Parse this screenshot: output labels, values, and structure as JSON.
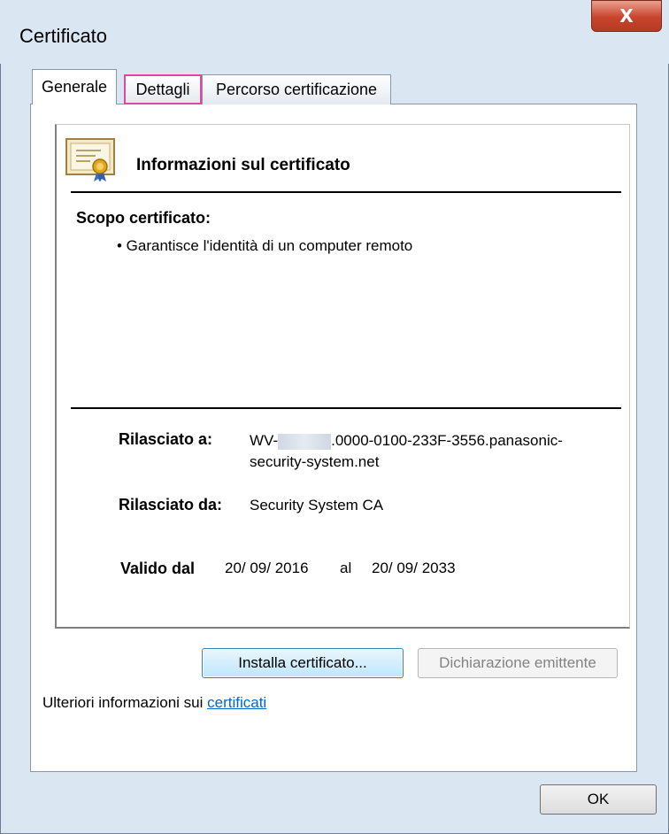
{
  "window": {
    "title": "Certificato",
    "close_glyph": "X"
  },
  "tabs": [
    {
      "label": "Generale",
      "selected": true
    },
    {
      "label": "Dettagli",
      "selected": false
    },
    {
      "label": "Percorso certificazione",
      "selected": false
    }
  ],
  "info": {
    "heading": "Informazioni sul certificato",
    "scope_heading": "Scopo certificato:",
    "scope_items": [
      "• Garantisce l'identità di un computer remoto"
    ],
    "issued_to_label": "Rilasciato a:",
    "issued_to_prefix": "WV-",
    "issued_to_suffix": ".0000-0100-233F-3556.panasonic-",
    "issued_to_line2": "security-system.net",
    "issued_by_label": "Rilasciato da:",
    "issued_by_value": "Security System CA",
    "valid_label": "Valido dal",
    "valid_from": "20/ 09/ 2016",
    "valid_sep": "al",
    "valid_to": "20/ 09/ 2033"
  },
  "buttons": {
    "install": "Installa certificato...",
    "issuer_statement": "Dichiarazione emittente",
    "ok": "OK"
  },
  "footer": {
    "more_info_text": "Ulteriori informazioni sui ",
    "link_text": "certificati"
  },
  "colors": {
    "highlight": "#e0479e",
    "link": "#0066cc",
    "close": "#c9432c"
  }
}
